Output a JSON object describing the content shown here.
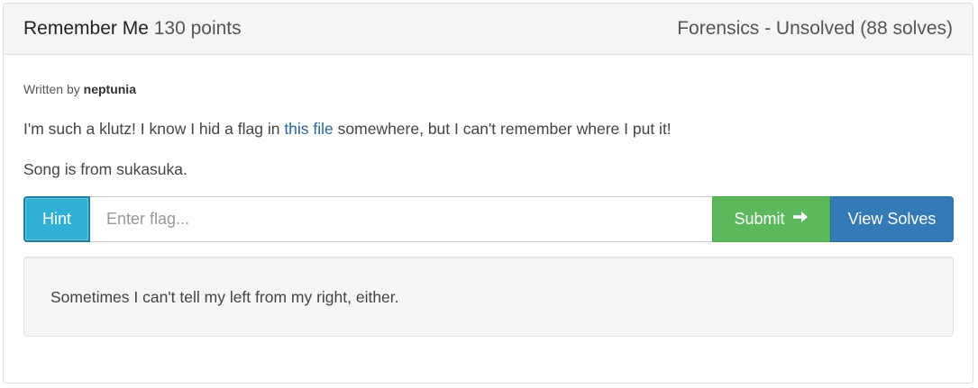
{
  "challenge": {
    "name": "Remember Me",
    "points": "130 points",
    "category_status": "Forensics - Unsolved (88 solves)",
    "written_by_label": "Written by",
    "author": "neptunia",
    "description_before_link": "I'm such a klutz! I know I hid a flag in ",
    "description_link": "this file",
    "description_after_link": " somewhere, but I can't remember where I put it!",
    "description_line2": "Song is from sukasuka."
  },
  "controls": {
    "hint_label": "Hint",
    "flag_placeholder": "Enter flag...",
    "flag_value": "",
    "submit_label": "Submit",
    "submit_icon": "arrow-right-icon",
    "view_solves_label": "View Solves"
  },
  "hint": {
    "text": "Sometimes I can't tell my left from my right, either."
  },
  "colors": {
    "hint_button": "#31b0d5",
    "submit_button": "#5cb85c",
    "view_solves_button": "#337ab7",
    "link": "#2a6496"
  }
}
